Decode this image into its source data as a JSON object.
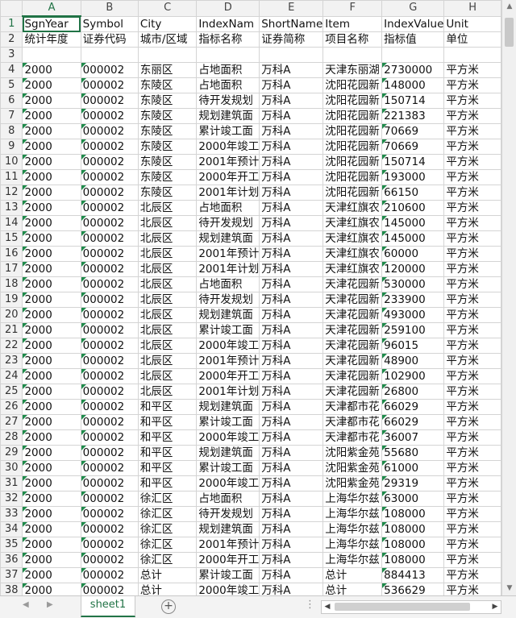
{
  "columns": [
    "A",
    "B",
    "C",
    "D",
    "E",
    "F",
    "G",
    "H"
  ],
  "header_row": [
    "SgnYear",
    "Symbol",
    "City",
    "IndexNam",
    "ShortName",
    "Item",
    "IndexValue",
    "Unit"
  ],
  "label_row": [
    "统计年度",
    "证券代码",
    "城市/区域",
    "指标名称",
    "证券简称",
    "项目名称",
    "指标值",
    "单位"
  ],
  "rows": [
    [
      "2000",
      "000002",
      "东丽区",
      "占地面积",
      "万科A",
      "天津东丽湖",
      "2730000",
      "平方米"
    ],
    [
      "2000",
      "000002",
      "东陵区",
      "占地面积",
      "万科A",
      "沈阳花园新",
      "148000",
      "平方米"
    ],
    [
      "2000",
      "000002",
      "东陵区",
      "待开发规划",
      "万科A",
      "沈阳花园新",
      "150714",
      "平方米"
    ],
    [
      "2000",
      "000002",
      "东陵区",
      "规划建筑面",
      "万科A",
      "沈阳花园新",
      "221383",
      "平方米"
    ],
    [
      "2000",
      "000002",
      "东陵区",
      "累计竣工面",
      "万科A",
      "沈阳花园新",
      "70669",
      "平方米"
    ],
    [
      "2000",
      "000002",
      "东陵区",
      "2000年竣工",
      "万科A",
      "沈阳花园新",
      "70669",
      "平方米"
    ],
    [
      "2000",
      "000002",
      "东陵区",
      "2001年预计",
      "万科A",
      "沈阳花园新",
      "150714",
      "平方米"
    ],
    [
      "2000",
      "000002",
      "东陵区",
      "2000年开工",
      "万科A",
      "沈阳花园新",
      "193000",
      "平方米"
    ],
    [
      "2000",
      "000002",
      "东陵区",
      "2001年计划",
      "万科A",
      "沈阳花园新",
      "66150",
      "平方米"
    ],
    [
      "2000",
      "000002",
      "北辰区",
      "占地面积",
      "万科A",
      "天津红旗农",
      "210600",
      "平方米"
    ],
    [
      "2000",
      "000002",
      "北辰区",
      "待开发规划",
      "万科A",
      "天津红旗农",
      "145000",
      "平方米"
    ],
    [
      "2000",
      "000002",
      "北辰区",
      "规划建筑面",
      "万科A",
      "天津红旗农",
      "145000",
      "平方米"
    ],
    [
      "2000",
      "000002",
      "北辰区",
      "2001年预计",
      "万科A",
      "天津红旗农",
      "60000",
      "平方米"
    ],
    [
      "2000",
      "000002",
      "北辰区",
      "2001年计划",
      "万科A",
      "天津红旗农",
      "120000",
      "平方米"
    ],
    [
      "2000",
      "000002",
      "北辰区",
      "占地面积",
      "万科A",
      "天津花园新",
      "530000",
      "平方米"
    ],
    [
      "2000",
      "000002",
      "北辰区",
      "待开发规划",
      "万科A",
      "天津花园新",
      "233900",
      "平方米"
    ],
    [
      "2000",
      "000002",
      "北辰区",
      "规划建筑面",
      "万科A",
      "天津花园新",
      "493000",
      "平方米"
    ],
    [
      "2000",
      "000002",
      "北辰区",
      "累计竣工面",
      "万科A",
      "天津花园新",
      "259100",
      "平方米"
    ],
    [
      "2000",
      "000002",
      "北辰区",
      "2000年竣工",
      "万科A",
      "天津花园新",
      "96015",
      "平方米"
    ],
    [
      "2000",
      "000002",
      "北辰区",
      "2001年预计",
      "万科A",
      "天津花园新",
      "48900",
      "平方米"
    ],
    [
      "2000",
      "000002",
      "北辰区",
      "2000年开工",
      "万科A",
      "天津花园新",
      "102900",
      "平方米"
    ],
    [
      "2000",
      "000002",
      "北辰区",
      "2001年计划",
      "万科A",
      "天津花园新",
      "26800",
      "平方米"
    ],
    [
      "2000",
      "000002",
      "和平区",
      "规划建筑面",
      "万科A",
      "天津都市花",
      "66029",
      "平方米"
    ],
    [
      "2000",
      "000002",
      "和平区",
      "累计竣工面",
      "万科A",
      "天津都市花",
      "66029",
      "平方米"
    ],
    [
      "2000",
      "000002",
      "和平区",
      "2000年竣工",
      "万科A",
      "天津都市花",
      "36007",
      "平方米"
    ],
    [
      "2000",
      "000002",
      "和平区",
      "规划建筑面",
      "万科A",
      "沈阳紫金苑",
      "55680",
      "平方米"
    ],
    [
      "2000",
      "000002",
      "和平区",
      "累计竣工面",
      "万科A",
      "沈阳紫金苑",
      "61000",
      "平方米"
    ],
    [
      "2000",
      "000002",
      "和平区",
      "2000年竣工",
      "万科A",
      "沈阳紫金苑",
      "29319",
      "平方米"
    ],
    [
      "2000",
      "000002",
      "徐汇区",
      "占地面积",
      "万科A",
      "上海华尔兹",
      "63000",
      "平方米"
    ],
    [
      "2000",
      "000002",
      "徐汇区",
      "待开发规划",
      "万科A",
      "上海华尔兹",
      "108000",
      "平方米"
    ],
    [
      "2000",
      "000002",
      "徐汇区",
      "规划建筑面",
      "万科A",
      "上海华尔兹",
      "108000",
      "平方米"
    ],
    [
      "2000",
      "000002",
      "徐汇区",
      "2001年预计",
      "万科A",
      "上海华尔兹",
      "108000",
      "平方米"
    ],
    [
      "2000",
      "000002",
      "徐汇区",
      "2000年开工",
      "万科A",
      "上海华尔兹",
      "108000",
      "平方米"
    ],
    [
      "2000",
      "000002",
      "总计",
      "累计竣工面",
      "万科A",
      "总计",
      "884413",
      "平方米"
    ],
    [
      "2000",
      "000002",
      "总计",
      "2000年竣工",
      "万科A",
      "总计",
      "536629",
      "平方米"
    ]
  ],
  "sheet_tab": "sheet1",
  "icons": {
    "nav_prev": "triangle-left-icon",
    "nav_next": "triangle-right-icon",
    "add_sheet": "plus-circle-icon",
    "more": "ellipsis-icon"
  },
  "accent_color": "#217346"
}
